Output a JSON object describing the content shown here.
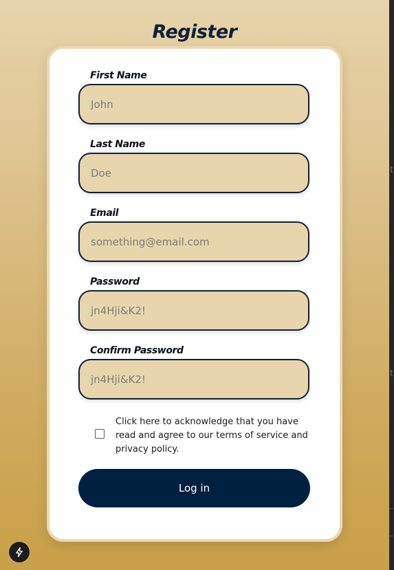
{
  "page": {
    "title": "Register"
  },
  "form": {
    "fields": [
      {
        "label": "First Name",
        "placeholder": "John",
        "value": ""
      },
      {
        "label": "Last Name",
        "placeholder": "Doe",
        "value": ""
      },
      {
        "label": "Email",
        "placeholder": "something@email.com",
        "value": ""
      },
      {
        "label": "Password",
        "placeholder": "jn4Hji&K2!",
        "value": ""
      },
      {
        "label": "Confirm Password",
        "placeholder": "jn4Hji&K2!",
        "value": ""
      }
    ],
    "terms": {
      "text": "Click here to acknowledge that you have read and agree to our terms of service and privacy policy.",
      "checked": false
    },
    "submit_label": "Log in"
  },
  "side_panel": {
    "glyph_1": "t",
    "glyph_2": "t"
  },
  "icons": {
    "dev_badge": "lightning-bolt-icon"
  },
  "colors": {
    "accent": "#00203f",
    "input_bg": "#e8d5ac",
    "background_top": "#e7d4ab",
    "background_bottom": "#c9a049"
  }
}
